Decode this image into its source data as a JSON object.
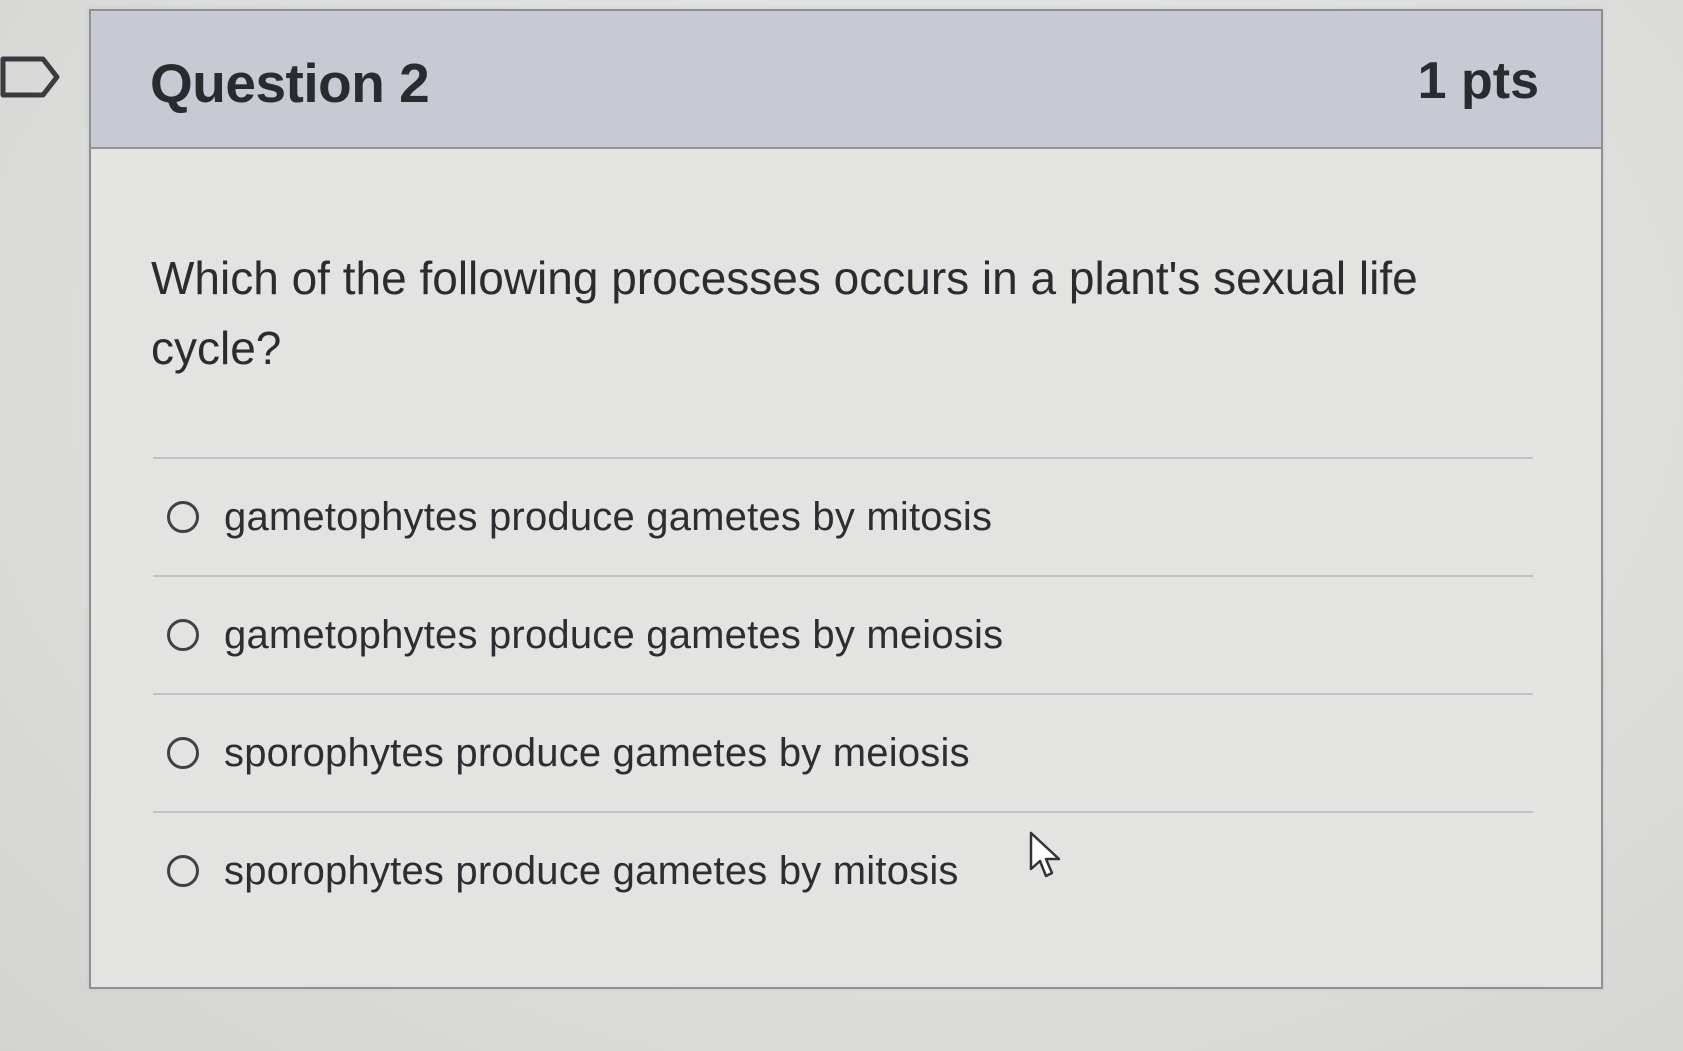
{
  "question": {
    "title": "Question 2",
    "points": "1 pts",
    "prompt": "Which of the following processes occurs in a plant's sexual life cycle?"
  },
  "answers": [
    {
      "label": "gametophytes produce gametes by mitosis",
      "selected": false
    },
    {
      "label": "gametophytes produce gametes by meiosis",
      "selected": false
    },
    {
      "label": "sporophytes produce gametes by meiosis",
      "selected": false
    },
    {
      "label": "sporophytes produce gametes by mitosis",
      "selected": false
    }
  ],
  "icons": {
    "flag": "flag-icon",
    "radio": "radio-button-icon",
    "cursor": "mouse-pointer-icon"
  },
  "colors": {
    "header_background": "#c7cad3",
    "card_background": "#e3e4e1",
    "text": "#2b2c30",
    "border": "#8d9093"
  }
}
